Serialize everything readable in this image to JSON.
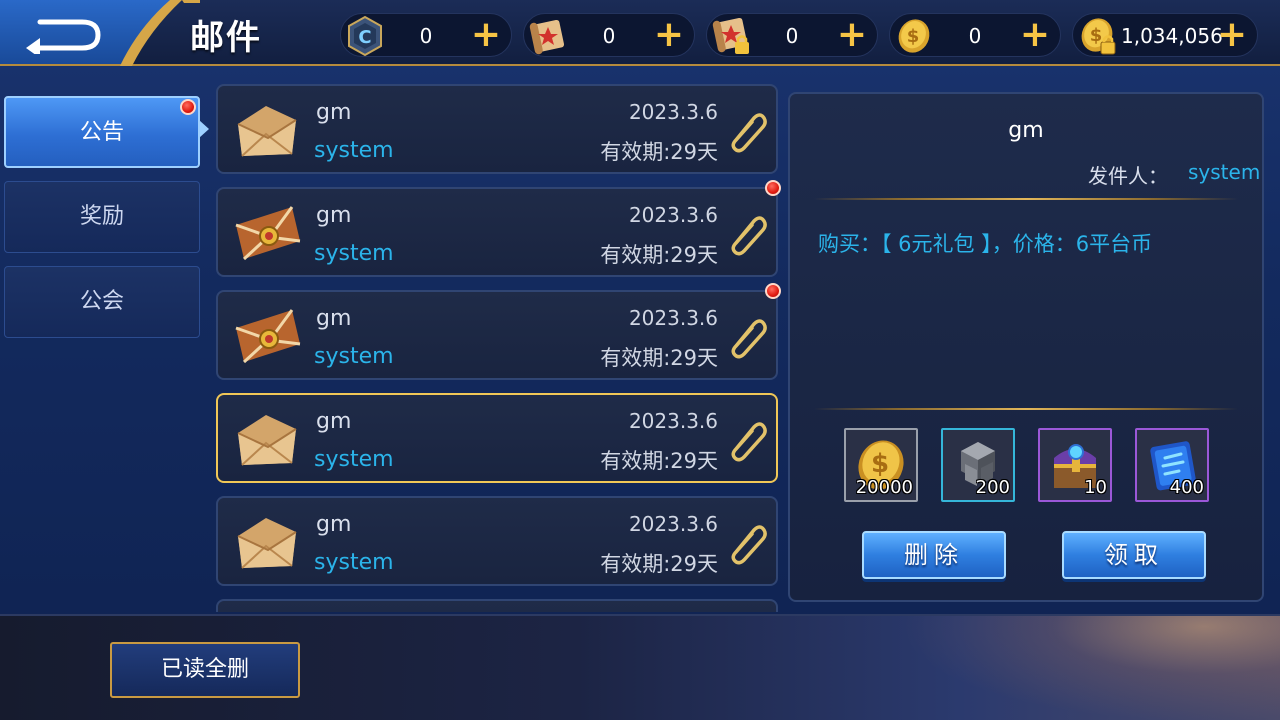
{
  "header": {
    "title": "邮件",
    "back_icon": "back-arrow-icon",
    "currencies": [
      {
        "name": "c-token",
        "icon": "c-token-icon",
        "value": "0"
      },
      {
        "name": "scroll",
        "icon": "scroll-icon",
        "value": "0"
      },
      {
        "name": "locked-scroll",
        "icon": "locked-scroll-icon",
        "value": "0"
      },
      {
        "name": "gold-coin",
        "icon": "gold-coin-icon",
        "value": "0"
      },
      {
        "name": "locked-gold-coin",
        "icon": "locked-gold-coin-icon",
        "value": "1,034,056"
      }
    ],
    "plus_label": "+"
  },
  "tabs": [
    {
      "label": "公告",
      "active": true,
      "has_dot": true
    },
    {
      "label": "奖励",
      "active": false,
      "has_dot": false
    },
    {
      "label": "公会",
      "active": false,
      "has_dot": false
    }
  ],
  "mails": [
    {
      "name": "gm",
      "sender": "system",
      "date": "2023.3.6",
      "validity": "有效期:29天",
      "envelope": "plain",
      "unread": false,
      "selected": false
    },
    {
      "name": "gm",
      "sender": "system",
      "date": "2023.3.6",
      "validity": "有效期:29天",
      "envelope": "sealed",
      "unread": true,
      "selected": false
    },
    {
      "name": "gm",
      "sender": "system",
      "date": "2023.3.6",
      "validity": "有效期:29天",
      "envelope": "sealed",
      "unread": true,
      "selected": false
    },
    {
      "name": "gm",
      "sender": "system",
      "date": "2023.3.6",
      "validity": "有效期:29天",
      "envelope": "plain",
      "unread": false,
      "selected": true
    },
    {
      "name": "gm",
      "sender": "system",
      "date": "2023.3.6",
      "validity": "有效期:29天",
      "envelope": "plain",
      "unread": false,
      "selected": false
    }
  ],
  "detail": {
    "title": "gm",
    "sender_label": "发件人：",
    "sender": "system",
    "body": "购买：【 6元礼包 】，价格：6平台币",
    "rewards": [
      {
        "icon": "gold-coin-icon",
        "count": "20000",
        "frame": "#9aa0ab"
      },
      {
        "icon": "gray-cube-icon",
        "count": "200",
        "frame": "#35b6d9"
      },
      {
        "icon": "treasure-chest-icon",
        "count": "10",
        "frame": "#9b58d8"
      },
      {
        "icon": "blue-scroll-icon",
        "count": "400",
        "frame": "#9b58d8"
      }
    ],
    "delete_label": "删除",
    "claim_label": "领取"
  },
  "footer": {
    "delete_all_label": "已读全删"
  },
  "colors": {
    "accent_blue": "#2bb4ea",
    "gold": "#e3b75a",
    "selected_border": "#f0c757",
    "unread_dot": "#e01b10"
  }
}
